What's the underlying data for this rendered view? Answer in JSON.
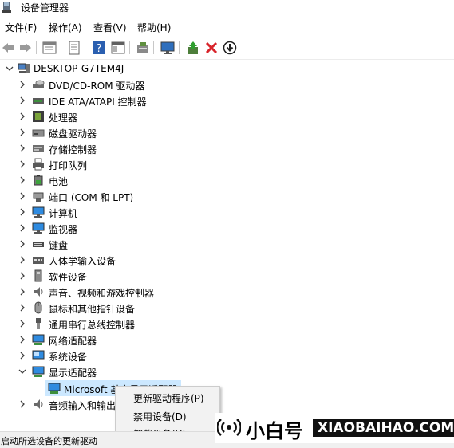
{
  "window": {
    "title": "设备管理器"
  },
  "menu": {
    "file": "文件(F)",
    "action": "操作(A)",
    "view": "查看(V)",
    "help": "帮助(H)"
  },
  "tree": {
    "root": "DESKTOP-G7TEM4J",
    "items": [
      {
        "label": "DVD/CD-ROM 驱动器",
        "icon": "dvd-drive-icon"
      },
      {
        "label": "IDE ATA/ATAPI 控制器",
        "icon": "ide-controller-icon"
      },
      {
        "label": "处理器",
        "icon": "processor-icon"
      },
      {
        "label": "磁盘驱动器",
        "icon": "disk-drive-icon"
      },
      {
        "label": "存储控制器",
        "icon": "storage-controller-icon"
      },
      {
        "label": "打印队列",
        "icon": "printer-icon"
      },
      {
        "label": "电池",
        "icon": "battery-icon"
      },
      {
        "label": "端口 (COM 和 LPT)",
        "icon": "port-icon"
      },
      {
        "label": "计算机",
        "icon": "computer-icon"
      },
      {
        "label": "监视器",
        "icon": "monitor-icon"
      },
      {
        "label": "键盘",
        "icon": "keyboard-icon"
      },
      {
        "label": "人体学输入设备",
        "icon": "hid-icon"
      },
      {
        "label": "软件设备",
        "icon": "software-device-icon"
      },
      {
        "label": "声音、视频和游戏控制器",
        "icon": "speaker-icon"
      },
      {
        "label": "鼠标和其他指针设备",
        "icon": "mouse-icon"
      },
      {
        "label": "通用串行总线控制器",
        "icon": "usb-icon"
      },
      {
        "label": "网络适配器",
        "icon": "network-adapter-icon"
      },
      {
        "label": "系统设备",
        "icon": "system-device-icon"
      },
      {
        "label": "显示适配器",
        "icon": "display-adapter-icon"
      }
    ],
    "child": "Microsoft 基本显示适配器",
    "after": "音频输入和输出"
  },
  "context_menu": {
    "update": "更新驱动程序(P)",
    "disable": "禁用设备(D)",
    "uninstall": "卸载设备(U)"
  },
  "status": {
    "text": "启动所选设备的更新驱动"
  },
  "watermark": {
    "cn": "小白号",
    "en": "XIAOBAIHAO.COM"
  },
  "colors": {
    "selection": "#cce8ff",
    "accent": "#0078d7",
    "delete_red": "#d8232a"
  }
}
